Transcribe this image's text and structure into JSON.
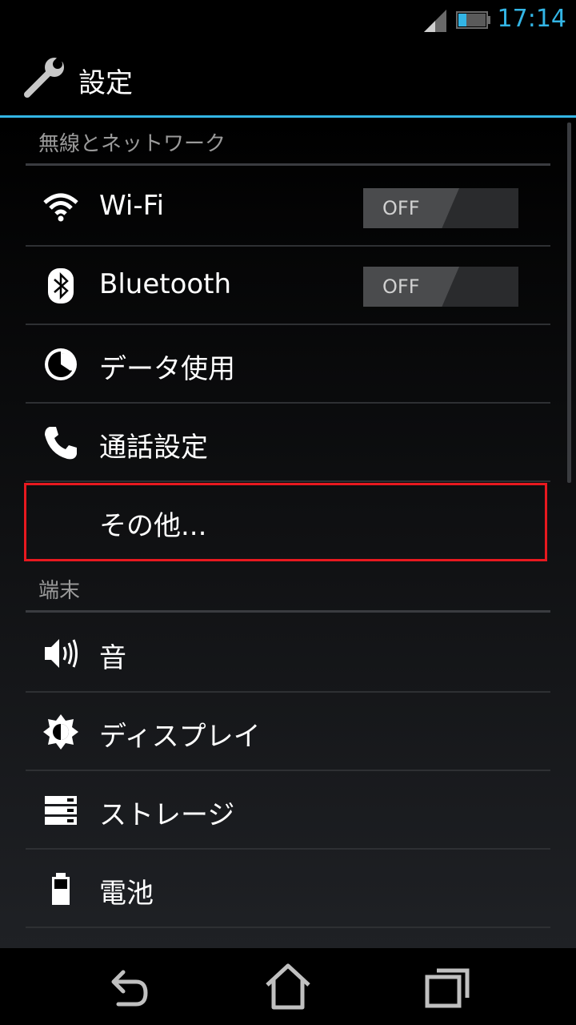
{
  "status_bar": {
    "time": "17:14",
    "signal_icon": "signal-icon",
    "battery_icon": "battery-icon"
  },
  "action_bar": {
    "title": "設定",
    "icon": "settings-wrench-icon"
  },
  "sections": [
    {
      "header": "無線とネットワーク",
      "items": [
        {
          "label": "Wi-Fi",
          "icon": "wifi-icon",
          "toggle": "OFF"
        },
        {
          "label": "Bluetooth",
          "icon": "bluetooth-icon",
          "toggle": "OFF"
        },
        {
          "label": "データ使用",
          "icon": "data-usage-icon"
        },
        {
          "label": "通話設定",
          "icon": "phone-icon"
        },
        {
          "label": "その他..."
        }
      ]
    },
    {
      "header": "端末",
      "items": [
        {
          "label": "音",
          "icon": "speaker-icon"
        },
        {
          "label": "ディスプレイ",
          "icon": "display-brightness-icon"
        },
        {
          "label": "ストレージ",
          "icon": "storage-icon"
        },
        {
          "label": "電池",
          "icon": "battery-setting-icon"
        }
      ]
    }
  ],
  "nav_bar": {
    "back_icon": "back-icon",
    "home_icon": "home-icon",
    "recents_icon": "recent-apps-icon"
  },
  "colors": {
    "accent": "#33b5e5",
    "highlight": "#e8191f"
  }
}
